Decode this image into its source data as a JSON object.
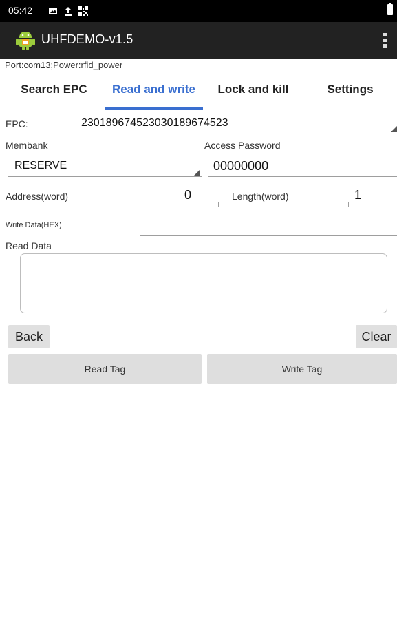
{
  "status_bar": {
    "time": "05:42",
    "icons": [
      "image-icon",
      "upload-icon",
      "qr-code-icon",
      "battery-icon"
    ]
  },
  "app_bar": {
    "title": "UHFDEMO-v1.5",
    "icon": "android-icon",
    "menu_icon": "overflow-menu-icon"
  },
  "port_info": "Port:com13;Power:rfid_power",
  "tabs": [
    {
      "label": "Search EPC",
      "active": false
    },
    {
      "label": "Read and write",
      "active": true
    },
    {
      "label": "Lock and kill",
      "active": false
    },
    {
      "label": "Settings",
      "active": false
    }
  ],
  "form": {
    "epc_label": "EPC:",
    "epc_value": "230189674523030189674523",
    "membank_label": "Membank",
    "membank_value": "RESERVE",
    "access_password_label": "Access Password",
    "access_password_value": "00000000",
    "address_label": "Address(word)",
    "address_value": "0",
    "length_label": "Length(word)",
    "length_value": "1",
    "write_data_label": "Write Data(HEX)",
    "write_data_value": "",
    "read_data_label": "Read Data",
    "read_data_value": ""
  },
  "buttons": {
    "back": "Back",
    "clear": "Clear",
    "read_tag": "Read Tag",
    "write_tag": "Write Tag"
  },
  "colors": {
    "accent": "#3a6fd0",
    "app_bar": "#222222",
    "status_bar": "#000000",
    "button": "#e0e0e0"
  }
}
